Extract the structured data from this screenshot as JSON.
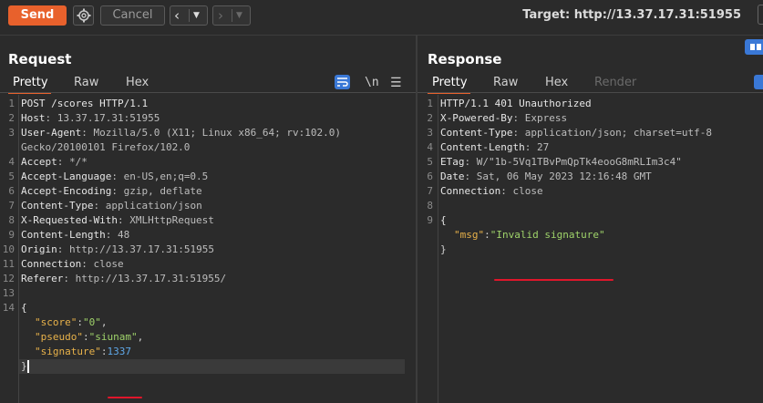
{
  "toolbar": {
    "send_label": "Send",
    "cancel_label": "Cancel",
    "target_label": "Target: http://13.37.17.31:51955"
  },
  "request": {
    "title": "Request",
    "tabs": [
      "Pretty",
      "Raw",
      "Hex"
    ],
    "tool_newline": "\\n",
    "lines": [
      {
        "n": "1",
        "k": "POST /scores HTTP/1.1",
        "v": ""
      },
      {
        "n": "2",
        "k": "Host",
        "v": ": 13.37.17.31:51955"
      },
      {
        "n": "3",
        "k": "User-Agent",
        "v": ": Mozilla/5.0 (X11; Linux x86_64; rv:102.0)"
      },
      {
        "n": "",
        "k": "",
        "v": "Gecko/20100101 Firefox/102.0"
      },
      {
        "n": "4",
        "k": "Accept",
        "v": ": */*"
      },
      {
        "n": "5",
        "k": "Accept-Language",
        "v": ": en-US,en;q=0.5"
      },
      {
        "n": "6",
        "k": "Accept-Encoding",
        "v": ": gzip, deflate"
      },
      {
        "n": "7",
        "k": "Content-Type",
        "v": ": application/json"
      },
      {
        "n": "8",
        "k": "X-Requested-With",
        "v": ": XMLHttpRequest"
      },
      {
        "n": "9",
        "k": "Content-Length",
        "v": ": 48"
      },
      {
        "n": "10",
        "k": "Origin",
        "v": ": http://13.37.17.31:51955"
      },
      {
        "n": "11",
        "k": "Connection",
        "v": ": close"
      },
      {
        "n": "12",
        "k": "Referer",
        "v": ": http://13.37.17.31:51955/"
      },
      {
        "n": "13",
        "k": "",
        "v": ""
      },
      {
        "n": "14",
        "k": "{",
        "v": ""
      }
    ],
    "json": [
      {
        "key": "\"score\"",
        "sep": ":",
        "val": "\"0\"",
        "trail": ",",
        "type": "str"
      },
      {
        "key": "\"pseudo\"",
        "sep": ":",
        "val": "\"siunam\"",
        "trail": ",",
        "type": "str"
      },
      {
        "key": "\"signature\"",
        "sep": ":",
        "val": "1337",
        "trail": "",
        "type": "num"
      }
    ],
    "close_brace": "}"
  },
  "response": {
    "title": "Response",
    "tabs": [
      "Pretty",
      "Raw",
      "Hex",
      "Render"
    ],
    "lines": [
      {
        "n": "1",
        "k": "HTTP/1.1 401 Unauthorized",
        "v": ""
      },
      {
        "n": "2",
        "k": "X-Powered-By",
        "v": ": Express"
      },
      {
        "n": "3",
        "k": "Content-Type",
        "v": ": application/json; charset=utf-8"
      },
      {
        "n": "4",
        "k": "Content-Length",
        "v": ": 27"
      },
      {
        "n": "5",
        "k": "ETag",
        "v": ": W/\"1b-5Vq1TBvPmQpTk4eooG8mRLIm3c4\""
      },
      {
        "n": "6",
        "k": "Date",
        "v": ": Sat, 06 May 2023 12:16:48 GMT"
      },
      {
        "n": "7",
        "k": "Connection",
        "v": ": close"
      },
      {
        "n": "8",
        "k": "",
        "v": ""
      },
      {
        "n": "9",
        "k": "{",
        "v": ""
      }
    ],
    "json": [
      {
        "key": "\"msg\"",
        "sep": ":",
        "val": "\"Invalid signature\"",
        "trail": "",
        "type": "str"
      }
    ],
    "close_brace": "}"
  },
  "colors": {
    "accent": "#e8612c",
    "annotation": "#e0162b",
    "json_key": "#e8b24a",
    "json_string": "#9fd36a",
    "json_number": "#5fa8e8"
  }
}
